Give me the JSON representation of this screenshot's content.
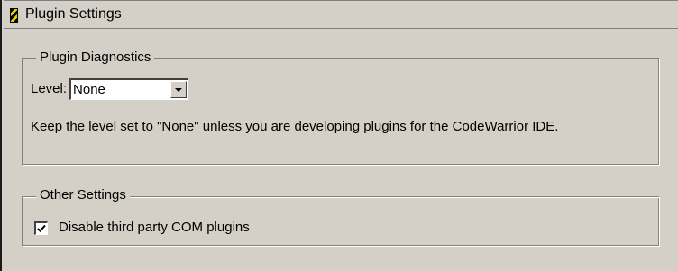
{
  "header": {
    "title": "Plugin Settings"
  },
  "diagnostics": {
    "group_title": "Plugin Diagnostics",
    "level_label": "Level:",
    "level_value": "None",
    "description": "Keep the level set to \"None\" unless you are developing plugins for the CodeWarrior IDE."
  },
  "other": {
    "group_title": "Other Settings",
    "checkbox_label": "Disable third party COM plugins",
    "checkbox_checked": true
  },
  "icons": {
    "header": "plugin-icon",
    "dropdown": "chevron-down-icon",
    "check": "checkmark-icon"
  }
}
